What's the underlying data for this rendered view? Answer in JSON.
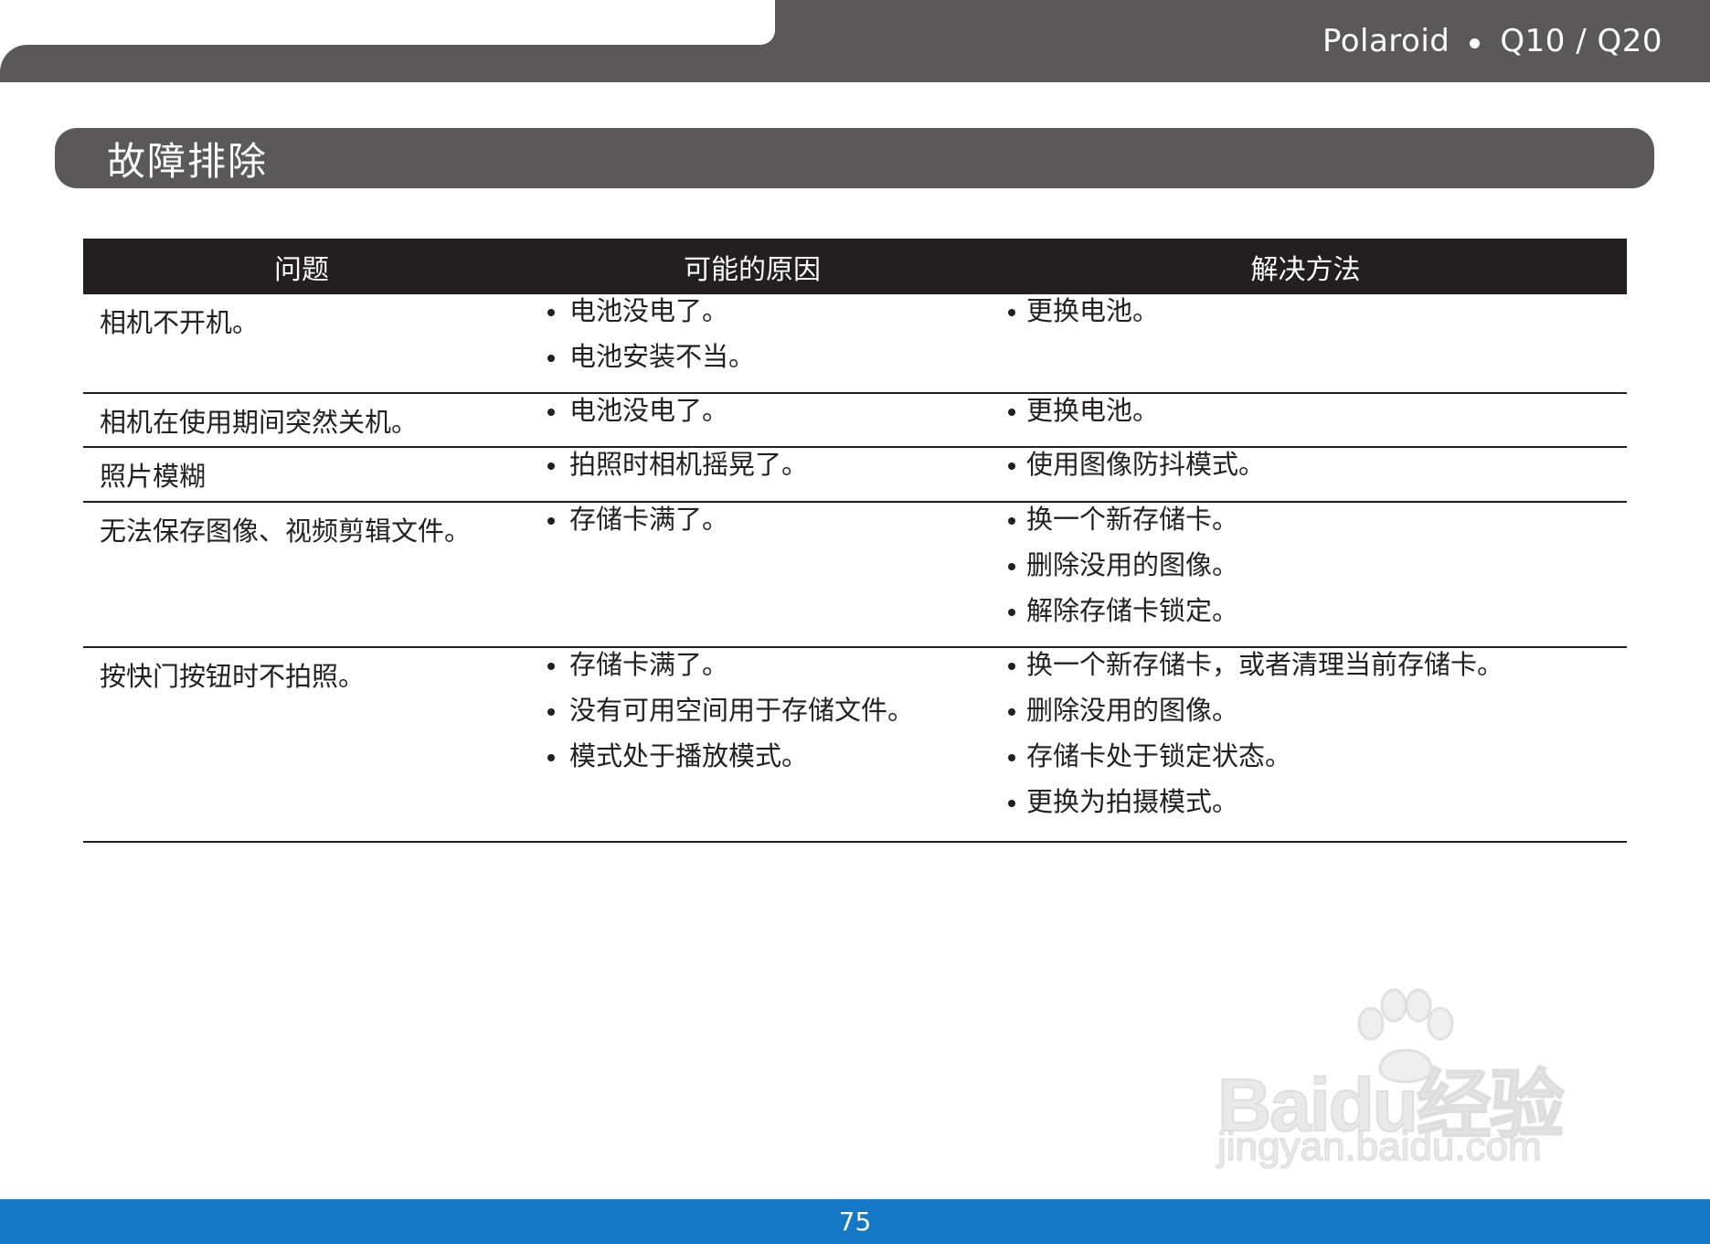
{
  "header": {
    "brand": "Polaroid",
    "model": "Q10 / Q20"
  },
  "section": {
    "title": "故障排除"
  },
  "table": {
    "columns": [
      "问题",
      "可能的原因",
      "解决方法"
    ],
    "rows": [
      {
        "problem": "相机不开机。",
        "causes": [
          "电池没电了。",
          "电池安装不当。"
        ],
        "solutions": [
          "更换电池。"
        ]
      },
      {
        "problem": "相机在使用期间突然关机。",
        "causes": [
          "电池没电了。"
        ],
        "solutions": [
          "更换电池。"
        ]
      },
      {
        "problem": "照片模糊",
        "causes": [
          "拍照时相机摇晃了。"
        ],
        "solutions": [
          "使用图像防抖模式。"
        ]
      },
      {
        "problem": "无法保存图像、视频剪辑文件。",
        "causes": [
          "存储卡满了。"
        ],
        "solutions": [
          "换一个新存储卡。",
          "删除没用的图像。",
          "解除存储卡锁定。"
        ]
      },
      {
        "problem": "按快门按钮时不拍照。",
        "causes": [
          "存储卡满了。",
          "没有可用空间用于存储文件。",
          "模式处于播放模式。"
        ],
        "solutions": [
          "换一个新存储卡，或者清理当前存储卡。",
          "删除没用的图像。",
          "存储卡处于锁定状态。",
          "更换为拍摄模式。"
        ]
      }
    ]
  },
  "watermark": {
    "logo": "Baidu经验",
    "url": "jingyan.baidu.com"
  },
  "footer": {
    "page_number": "75"
  },
  "colors": {
    "header_gray": "#5a5859",
    "table_header": "#231f20",
    "footer_blue": "#1478c6"
  }
}
